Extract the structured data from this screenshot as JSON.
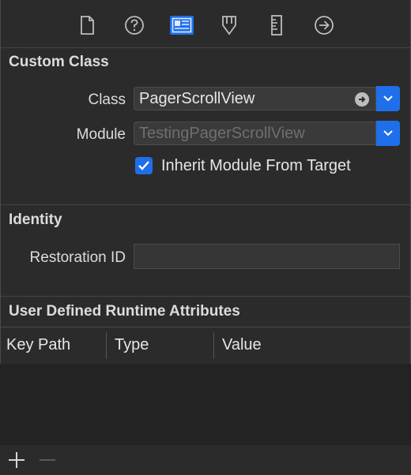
{
  "toolbar": {
    "icons": [
      "file-inspector-icon",
      "quick-help-icon",
      "identity-inspector-icon",
      "attributes-inspector-icon",
      "size-inspector-icon",
      "connections-inspector-icon"
    ],
    "active": "identity-inspector-icon",
    "accent": "#1f6feb"
  },
  "custom_class": {
    "title": "Custom Class",
    "class_label": "Class",
    "class_value": "PagerScrollView",
    "module_label": "Module",
    "module_placeholder": "TestingPagerScrollView",
    "inherit_label": "Inherit Module From Target",
    "inherit_checked": true
  },
  "identity": {
    "title": "Identity",
    "restoration_label": "Restoration ID",
    "restoration_value": ""
  },
  "runtime_attributes": {
    "title": "User Defined Runtime Attributes",
    "columns": [
      "Key Path",
      "Type",
      "Value"
    ],
    "rows": []
  },
  "bottom_bar": {
    "add_icon": "plus-icon",
    "remove_icon": "minus-icon"
  }
}
